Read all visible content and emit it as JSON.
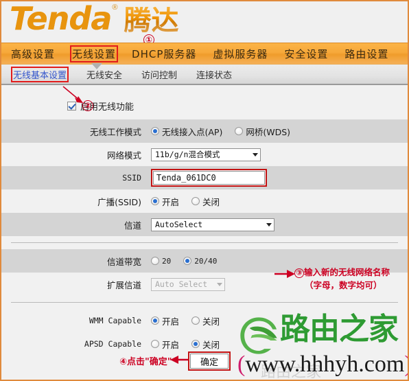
{
  "brand": {
    "logo_text": "Tenda",
    "logo_reg": "®",
    "logo_cn": "腾达"
  },
  "nav": {
    "items": [
      {
        "label": "高级设置",
        "highlighted": false
      },
      {
        "label": "无线设置",
        "highlighted": true
      },
      {
        "label": "DHCP服务器",
        "highlighted": false
      },
      {
        "label": "虚拟服务器",
        "highlighted": false
      },
      {
        "label": "安全设置",
        "highlighted": false
      },
      {
        "label": "路由设置",
        "highlighted": false
      }
    ]
  },
  "subnav": {
    "items": [
      {
        "label": "无线基本设置",
        "active": true
      },
      {
        "label": "无线安全",
        "active": false
      },
      {
        "label": "访问控制",
        "active": false
      },
      {
        "label": "连接状态",
        "active": false
      }
    ]
  },
  "form": {
    "enable_wireless": {
      "label": "启用无线功能",
      "checked": true
    },
    "work_mode": {
      "label": "无线工作模式",
      "options": [
        {
          "label": "无线接入点(AP)",
          "selected": true
        },
        {
          "label": "网桥(WDS)",
          "selected": false
        }
      ]
    },
    "network_mode": {
      "label": "网络模式",
      "value": "11b/g/n混合模式"
    },
    "ssid": {
      "label": "SSID",
      "value": "Tenda_061DC0"
    },
    "broadcast": {
      "label": "广播(SSID)",
      "options": [
        {
          "label": "开启",
          "selected": true
        },
        {
          "label": "关闭",
          "selected": false
        }
      ]
    },
    "channel": {
      "label": "信道",
      "value": "AutoSelect"
    },
    "channel_bandwidth": {
      "label": "信道带宽",
      "options": [
        {
          "label": "20",
          "selected": false
        },
        {
          "label": "20/40",
          "selected": true
        }
      ]
    },
    "extension_channel": {
      "label": "扩展信道",
      "value": "Auto Select",
      "disabled": true
    },
    "wmm_capable": {
      "label": "WMM Capable",
      "options": [
        {
          "label": "开启",
          "selected": true
        },
        {
          "label": "关闭",
          "selected": false
        }
      ]
    },
    "apsd_capable": {
      "label": "APSD Capable",
      "options": [
        {
          "label": "开启",
          "selected": false
        },
        {
          "label": "关闭",
          "selected": true
        }
      ]
    },
    "confirm_button": "确定"
  },
  "annotations": {
    "one": "①",
    "two": "②",
    "three_num": "③",
    "three_line1": "输入新的无线网络名称",
    "three_line2": "（字母，数字均可）",
    "four": "④点击\"确定\""
  },
  "watermark": {
    "cn": "路由之家",
    "url": "www.hhhyh.com",
    "paren_open": "(",
    "paren_close": ")",
    "ghost": "路由之家"
  },
  "colors": {
    "brand_orange": "#f09c2b",
    "annotation_red": "#cc0022",
    "link_blue": "#3355cc",
    "watermark_green": "#2e9b33"
  }
}
